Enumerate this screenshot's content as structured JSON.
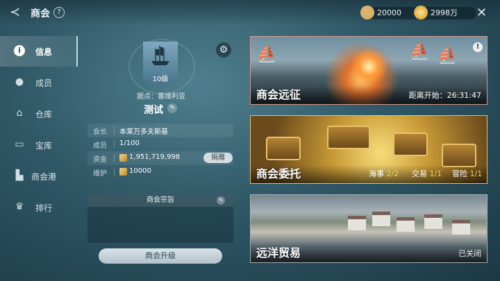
{
  "header": {
    "back_icon": "back-arrow-icon",
    "title": "商会",
    "help": "?",
    "resources": [
      {
        "name": "bounty-scroll-icon",
        "value": "20000",
        "color": "#e2c07a"
      },
      {
        "name": "gold-coin-icon",
        "value": "2998万",
        "color": "#f2cd5c"
      }
    ],
    "close": "✕"
  },
  "sidebar": {
    "items": [
      {
        "label": "信息",
        "icon": "info-icon",
        "glyph": "i"
      },
      {
        "label": "成员",
        "icon": "person-icon",
        "glyph": "●"
      },
      {
        "label": "仓库",
        "icon": "home-icon",
        "glyph": "⌂"
      },
      {
        "label": "宝库",
        "icon": "chest-icon",
        "glyph": "▭"
      },
      {
        "label": "商会港",
        "icon": "port-icon",
        "glyph": "▙"
      },
      {
        "label": "排行",
        "icon": "crown-icon",
        "glyph": "♛"
      }
    ],
    "active_index": 0
  },
  "guild": {
    "level": "10级",
    "base": "据点：塞维利亚",
    "name": "测试",
    "info": [
      {
        "key": "会长",
        "value": "本莱万多夫斯基"
      },
      {
        "key": "成员",
        "value": "1/100"
      },
      {
        "key": "资金",
        "value": "1,951,719,998"
      },
      {
        "key": "维护",
        "value": "10000"
      }
    ],
    "donate_label": "捐赠",
    "motto_title": "商会宗旨",
    "upgrade_label": "商会升级"
  },
  "cards": {
    "expedition": {
      "title": "商会远征",
      "countdown": "距离开始：26:31:47",
      "alert": "!"
    },
    "commission": {
      "title": "商会委托",
      "stats": [
        {
          "label": "海事",
          "value": "2/2"
        },
        {
          "label": "交易",
          "value": "1/1"
        },
        {
          "label": "冒险",
          "value": "1/1"
        }
      ]
    },
    "trade": {
      "title": "远洋贸易",
      "status": "已关闭"
    }
  }
}
